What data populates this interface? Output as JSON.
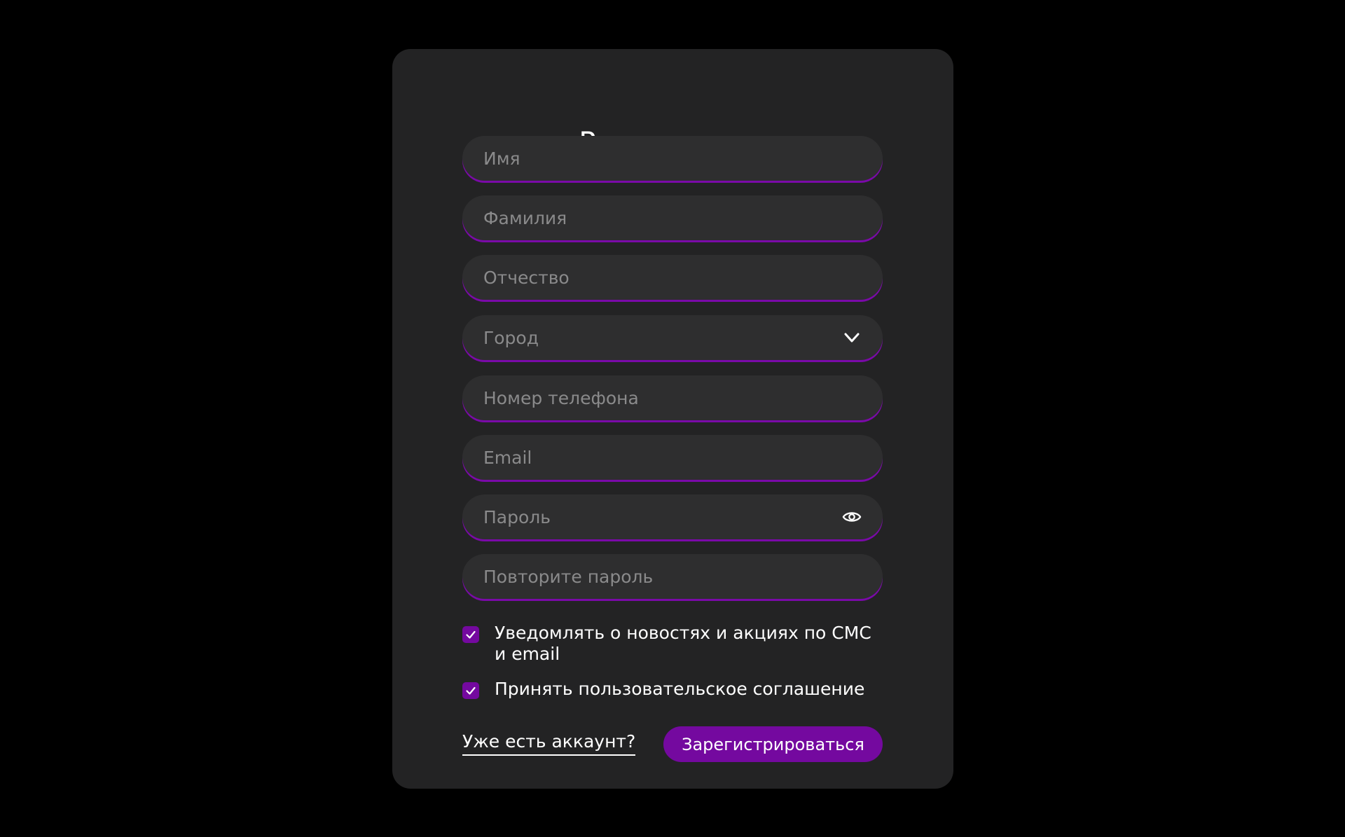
{
  "form": {
    "title": "Регистрация",
    "fields": [
      {
        "placeholder": "Имя",
        "value": ""
      },
      {
        "placeholder": "Фамилия",
        "value": ""
      },
      {
        "placeholder": "Отчество",
        "value": ""
      },
      {
        "placeholder": "Город",
        "value": "",
        "icon": "chevron-down-icon"
      },
      {
        "placeholder": "Номер телефона",
        "value": ""
      },
      {
        "placeholder": "Email",
        "value": ""
      },
      {
        "placeholder": "Пароль",
        "value": "",
        "icon": "eye-icon"
      },
      {
        "placeholder": "Повторите пароль",
        "value": ""
      }
    ],
    "checkboxes": [
      {
        "label": "Уведомлять о новостях и акциях по СМС и email",
        "checked": true
      },
      {
        "label": "Принять пользовательское соглашение",
        "checked": true
      }
    ],
    "login_link": "Уже есть аккаунт?",
    "submit_label": "Зарегистрироваться"
  },
  "colors": {
    "background": "#000000",
    "card": "#232324",
    "field": "#2e2e2f",
    "accent": "#74099f",
    "placeholder": "#8a8a8b",
    "text": "#ffffff"
  }
}
